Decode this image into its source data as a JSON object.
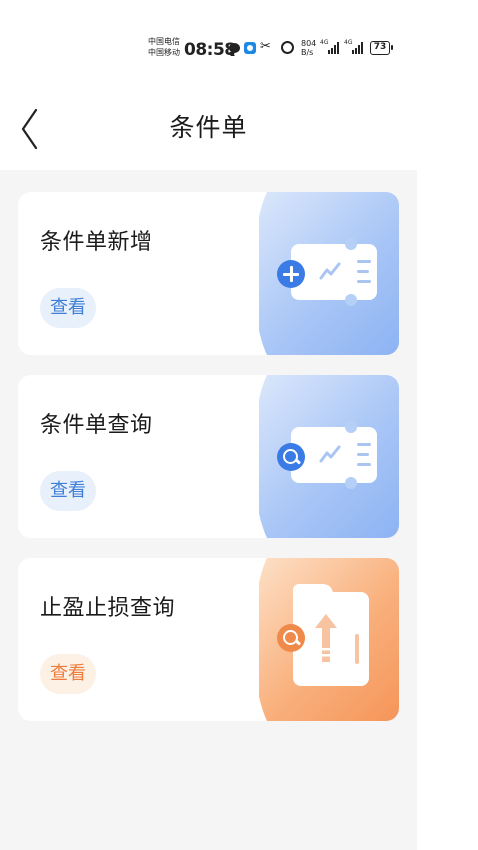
{
  "status_bar": {
    "carrier_1": "中国电信",
    "carrier_2": "中国移动",
    "time": "08:58",
    "net_speed_value": "804",
    "net_speed_unit": "B/s",
    "signal_1_label": "4G",
    "signal_2_label": "4G",
    "battery": "73",
    "icons": [
      "chat-icon",
      "app-icon",
      "scissor-icon",
      "alarm-icon",
      "signal-icon",
      "signal-icon",
      "battery-icon"
    ]
  },
  "header": {
    "back_icon": "back-arrow-icon",
    "title": "条件单"
  },
  "cards": [
    {
      "title": "条件单新增",
      "button": "查看",
      "theme": "blue",
      "icon": "add-ticket-icon"
    },
    {
      "title": "条件单查询",
      "button": "查看",
      "theme": "blue",
      "icon": "search-ticket-icon"
    },
    {
      "title": "止盈止损查询",
      "button": "查看",
      "theme": "orange",
      "icon": "search-folder-icon"
    }
  ],
  "colors": {
    "page_background": "#f5f5f6",
    "card_background": "#ffffff",
    "blue_accent": "#3b7be6",
    "blue_button_text": "#3f7fd6",
    "orange_accent": "#f08a4b",
    "orange_button_text": "#ee7d3b"
  }
}
